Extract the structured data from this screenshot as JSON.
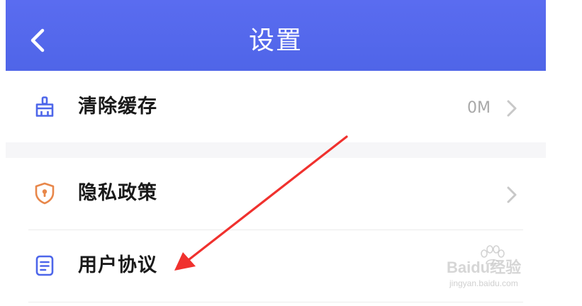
{
  "header": {
    "title": "设置",
    "back_icon": "chevron-left-icon"
  },
  "settings": {
    "items": [
      {
        "icon": "broom-icon",
        "label": "清除缓存",
        "value": "0M",
        "has_chevron": true
      },
      {
        "icon": "shield-lock-icon",
        "label": "隐私政策",
        "value": "",
        "has_chevron": true
      },
      {
        "icon": "document-icon",
        "label": "用户协议",
        "value": "",
        "has_chevron": false
      }
    ]
  },
  "watermark": {
    "brand": "Baidu经验",
    "url": "jingyan.baidu.com"
  },
  "colors": {
    "header": "#5367EC",
    "icon_blue": "#4D66EA",
    "icon_orange": "#E8874A",
    "annotation_arrow": "#F0312E",
    "chevron": "#C8C8C8"
  }
}
